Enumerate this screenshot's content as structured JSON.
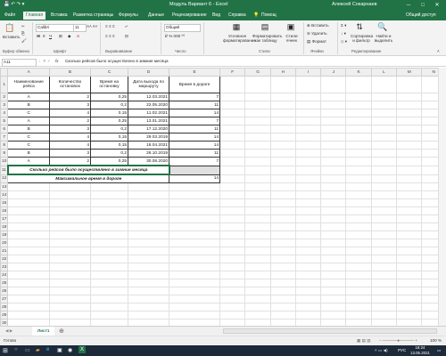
{
  "titlebar": {
    "title": "Модуль Вариант 6  -  Excel",
    "user": "Алексей Сокарнаев",
    "min": "─",
    "max": "□",
    "close": "✕"
  },
  "tabs": [
    "Файл",
    "Главная",
    "Вставка",
    "Разметка страницы",
    "Формулы",
    "Данные",
    "Рецензирование",
    "Вид",
    "Справка",
    "Помощь"
  ],
  "tell_me": "Помощ",
  "share": "Общий доступ",
  "ribbon": {
    "paste": "Вставить",
    "clipboard": "Буфер обмена",
    "font_name": "Calibri",
    "font_size": "11",
    "font_group": "Шрифт",
    "align_group": "Выравнивание",
    "number_format": "Общий",
    "number_group": "Число",
    "cond_format": "Условное форматирование",
    "format_table": "Форматировать как таблицу",
    "cell_styles": "Стили ячеек",
    "styles_group": "Стили",
    "insert": "Вставить",
    "delete": "Удалить",
    "format": "Формат",
    "cells_group": "Ячейки",
    "sort": "Сортировка и фильтр",
    "find": "Найти и выделить",
    "edit_group": "Редактирование"
  },
  "formula_bar": {
    "name_box": "A11",
    "fx": "fx",
    "content": "Сколько рейсов было осуществлено в зимние месяца"
  },
  "columns": [
    "A",
    "B",
    "C",
    "D",
    "E",
    "F",
    "G",
    "H",
    "I",
    "J",
    "K",
    "L",
    "M",
    "N"
  ],
  "table": {
    "headers": [
      "Наименование рейса",
      "Количество остановок",
      "Время на остановку",
      "Дата выхода по маршруту",
      "Время в дороге"
    ],
    "rows": [
      [
        "A",
        "2",
        "0,25",
        "12.03.2021",
        "7"
      ],
      [
        "B",
        "3",
        "0,2",
        "22.05.2020",
        "11"
      ],
      [
        "C",
        "4",
        "0,15",
        "11.02.2021",
        "14"
      ],
      [
        "A",
        "2",
        "0,25",
        "13.01.2021",
        "7"
      ],
      [
        "B",
        "3",
        "0,2",
        "17.12.2020",
        "11"
      ],
      [
        "C",
        "4",
        "0,15",
        "29.03.2019",
        "14"
      ],
      [
        "C",
        "4",
        "0,15",
        "18.04.2021",
        "14"
      ],
      [
        "B",
        "3",
        "0,2",
        "26.10.2019",
        "11"
      ],
      [
        "A",
        "2",
        "0,25",
        "30.08.2020",
        "7"
      ]
    ],
    "row11_label": "Сколько рейсов было осуществлено в зимние месяца",
    "row12_label": "Максимальное время в дороге",
    "row12_value": "14"
  },
  "sheet_tab": "Лист1",
  "status": {
    "ready": "Готово",
    "zoom": "100 %"
  },
  "taskbar": {
    "time": "18:24",
    "date": "13.05.2021",
    "lang": "РУС"
  }
}
